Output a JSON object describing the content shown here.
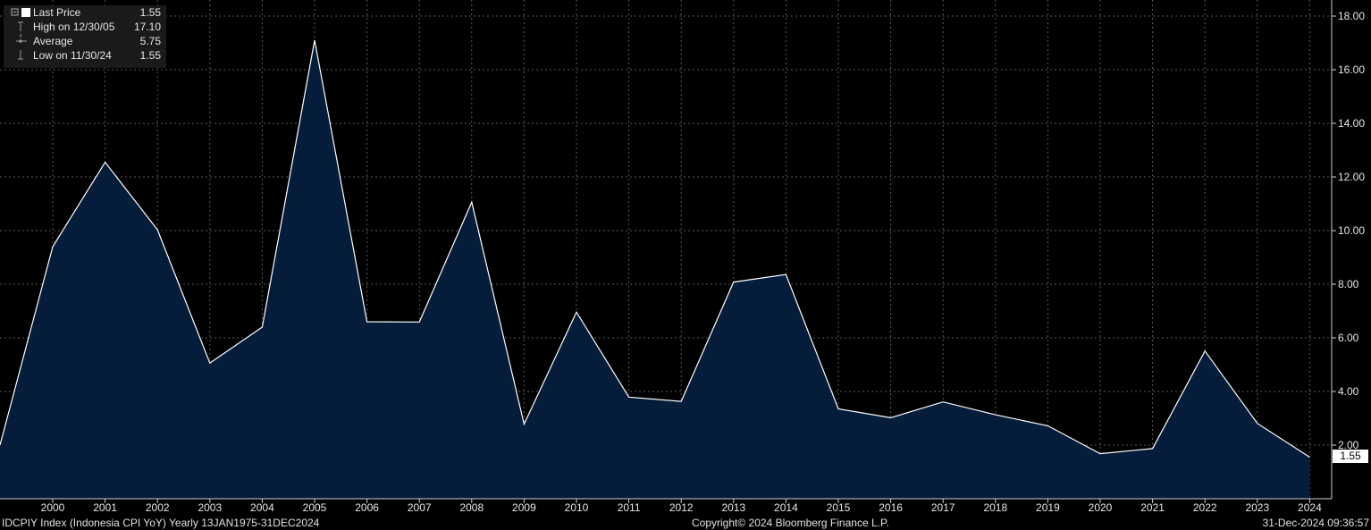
{
  "chart_data": {
    "type": "area",
    "x": [
      "1999",
      "2000",
      "2001",
      "2002",
      "2003",
      "2004",
      "2005",
      "2006",
      "2007",
      "2008",
      "2009",
      "2010",
      "2011",
      "2012",
      "2013",
      "2014",
      "2015",
      "2016",
      "2017",
      "2018",
      "2019",
      "2020",
      "2021",
      "2022",
      "2023",
      "2024"
    ],
    "categories": [
      "2000",
      "2001",
      "2002",
      "2003",
      "2004",
      "2005",
      "2006",
      "2007",
      "2008",
      "2009",
      "2010",
      "2011",
      "2012",
      "2013",
      "2014",
      "2015",
      "2016",
      "2017",
      "2018",
      "2019",
      "2020",
      "2021",
      "2022",
      "2023",
      "2024"
    ],
    "values": [
      2.0,
      9.4,
      12.55,
      10.03,
      5.06,
      6.4,
      17.1,
      6.6,
      6.59,
      11.06,
      2.78,
      6.96,
      3.79,
      3.63,
      8.08,
      8.36,
      3.35,
      3.02,
      3.61,
      3.13,
      2.72,
      1.68,
      1.87,
      5.51,
      2.81,
      1.55
    ],
    "ylim": [
      0,
      18
    ],
    "yticks": [
      "2.00",
      "4.00",
      "6.00",
      "8.00",
      "10.00",
      "12.00",
      "14.00",
      "16.00",
      "18.00"
    ],
    "ytick_values": [
      2,
      4,
      6,
      8,
      10,
      12,
      14,
      16,
      18
    ],
    "grid": true,
    "colors": {
      "line": "#ffffff",
      "fill": "#051c3b",
      "grid": "#5a5a5a",
      "background": "#000000"
    },
    "last_value_label": "1.55"
  },
  "legend": {
    "rows": [
      {
        "label": "Last Price",
        "value": "1.55"
      },
      {
        "label": "High on 12/30/05",
        "value": "17.10"
      },
      {
        "label": "Average",
        "value": "5.75"
      },
      {
        "label": "Low on 11/30/24",
        "value": "1.55"
      }
    ]
  },
  "footer": {
    "left": "IDCPIY Index (Indonesia CPI YoY)  Yearly 13JAN1975-31DEC2024",
    "center": "Copyright© 2024 Bloomberg Finance L.P.",
    "right": "31-Dec-2024 09:36:57"
  }
}
